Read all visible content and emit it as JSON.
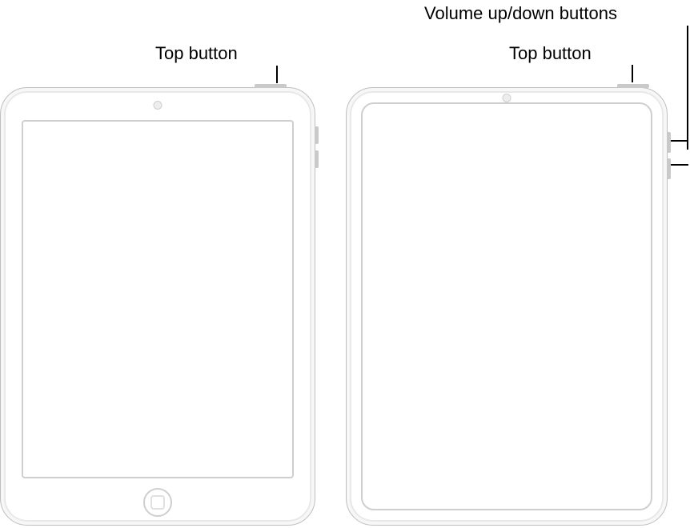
{
  "labels": {
    "left_top_button": "Top button",
    "right_top_button": "Top button",
    "volume_buttons": "Volume up/down buttons"
  }
}
